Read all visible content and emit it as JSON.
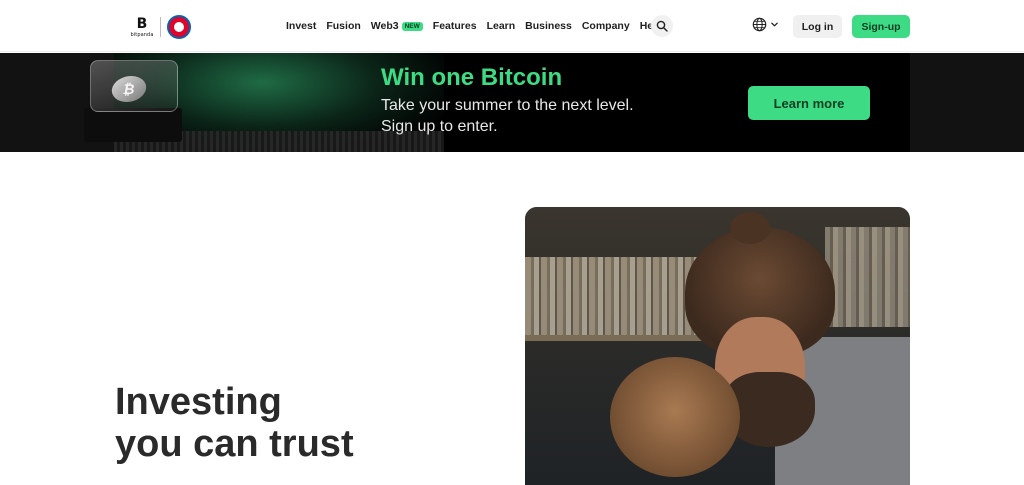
{
  "header": {
    "brand": "bitpanda",
    "nav": [
      {
        "label": "Invest"
      },
      {
        "label": "Fusion"
      },
      {
        "label": "Web3",
        "badge": "NEW"
      },
      {
        "label": "Features"
      },
      {
        "label": "Learn"
      },
      {
        "label": "Business"
      },
      {
        "label": "Company"
      },
      {
        "label": "Help"
      }
    ],
    "search_icon": "search-icon",
    "language_icon": "globe-icon",
    "login_label": "Log in",
    "signup_label": "Sign-up"
  },
  "banner": {
    "title": "Win one Bitcoin",
    "subtitle_line1": "Take your summer to the next level.",
    "subtitle_line2": "Sign up to enter.",
    "cta_label": "Learn more",
    "coin_symbol": "₿"
  },
  "hero": {
    "title_line1": "Investing",
    "title_line2": "you can trust"
  },
  "colors": {
    "accent": "#3ddc84",
    "banner_bg": "#000000",
    "text_dark": "#2a2a2a"
  }
}
